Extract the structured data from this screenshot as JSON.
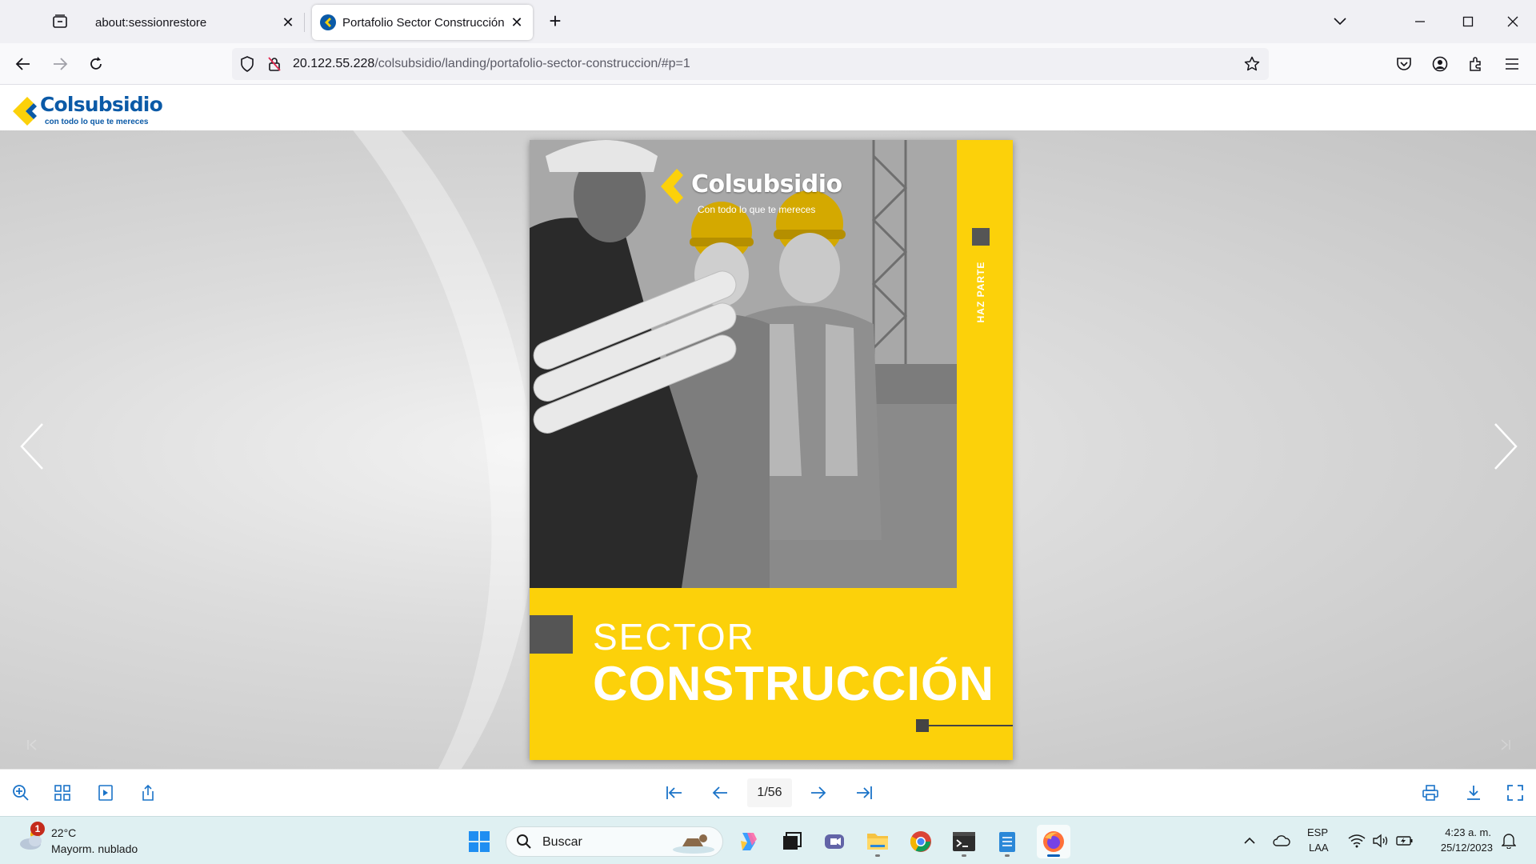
{
  "browser": {
    "tabs": [
      {
        "title": "about:sessionrestore"
      },
      {
        "title": "Portafolio Sector Construcción Colsubsidio"
      }
    ],
    "url": {
      "host": "20.122.55.228",
      "path": "/colsubsidio/landing/portafolio-sector-construccion/#p=1"
    }
  },
  "site": {
    "logo_word": "Colsubsidio",
    "logo_tagline": "con todo lo que te mereces"
  },
  "cover": {
    "logo_word": "Colsubsidio",
    "logo_tagline": "Con todo lo que te mereces",
    "strip_text": "HAZ PARTE",
    "title_line1": "SECTOR",
    "title_line2": "CONSTRUCCIÓN"
  },
  "viewer": {
    "page_indicator": "1/56"
  },
  "taskbar": {
    "weather": {
      "badge": "1",
      "temp": "22°C",
      "desc": "Mayorm. nublado"
    },
    "search_label": "Buscar",
    "language": {
      "line1": "ESP",
      "line2": "LAA"
    },
    "clock": {
      "time": "4:23 a. m.",
      "date": "25/12/2023"
    }
  },
  "colors": {
    "brand_blue": "#0b5aa7",
    "brand_yellow": "#fcd10a",
    "taskbar_bg": "#dff0f2"
  }
}
